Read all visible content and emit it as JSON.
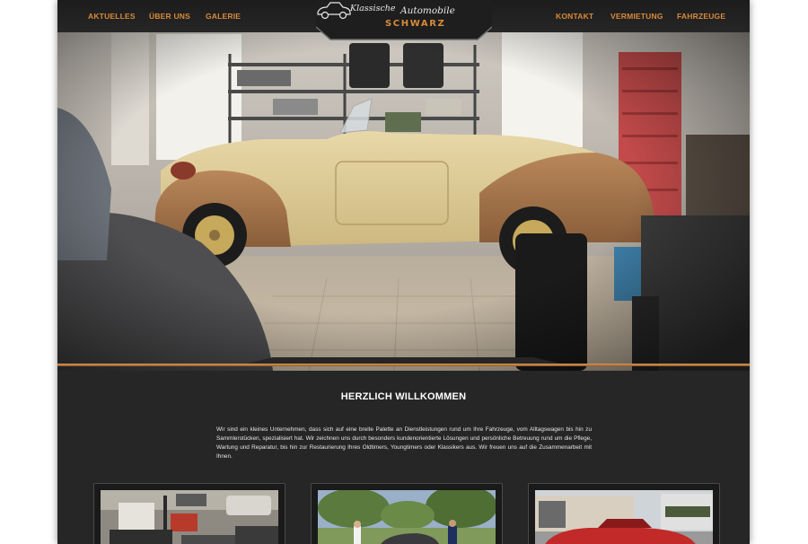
{
  "nav": {
    "left_items": [
      {
        "label": "AKTUELLES"
      },
      {
        "label": "ÜBER UNS"
      },
      {
        "label": "GALERIE"
      }
    ],
    "right_items": [
      {
        "label": "KONTAKT"
      },
      {
        "label": "VERMIETUNG"
      },
      {
        "label": "FAHRZEUGE"
      }
    ]
  },
  "logo": {
    "script_1": "Klassische",
    "script_2": "Automobile",
    "name": "SCHWARZ"
  },
  "welcome": {
    "title": "HERZLICH WILLKOMMEN",
    "text": "Wir sind ein kleines Unternehmen, dass sich auf eine breite Palette an Dienstleistungen rund um Ihre Fahrzeuge, vom Alltagswagen bis hin zu Sammlerstücken, spezialisiert hat. Wir zeichnen uns durch besonders kundenorientierte Lösungen und persönliche Betreuung rund um die Pflege, Wartung und Reparatur, bis hin zur Restaurierung Ihres Oldtimers, Youngtimers oder Klassikers aus. Wir freuen uns auf die Zusammenarbeit mit Ihnen."
  },
  "colors": {
    "accent": "#d98a3a",
    "page_bg": "#262626",
    "text": "#ffffff"
  },
  "icons": {
    "logo_car": "vintage-car-icon"
  }
}
